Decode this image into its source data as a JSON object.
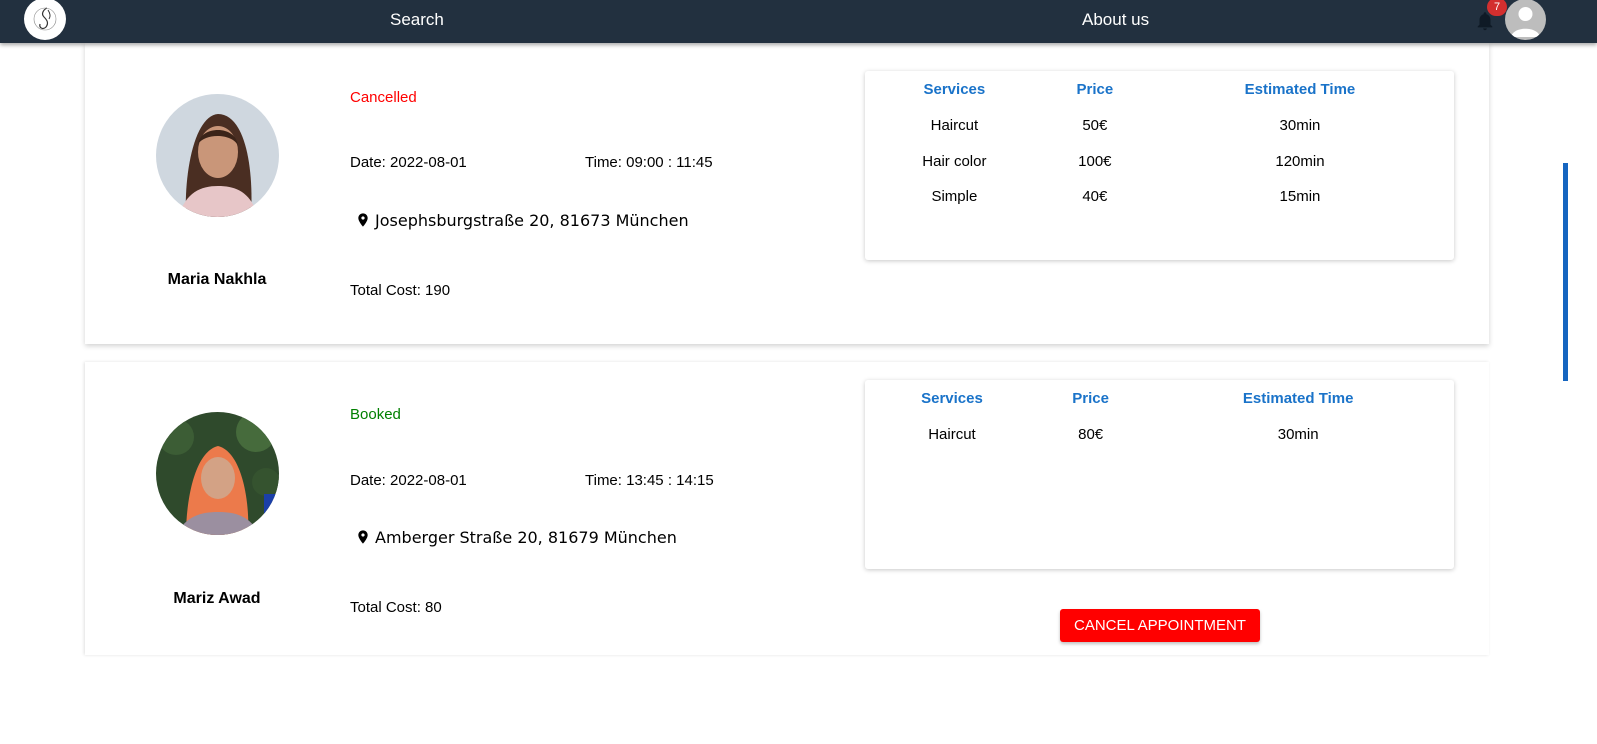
{
  "nav": {
    "search_label": "Search",
    "about_label": "About us",
    "notification_count": "7"
  },
  "table_headers": {
    "services": "Services",
    "price": "Price",
    "estimated_time": "Estimated Time"
  },
  "appointments": [
    {
      "name": "Maria Nakhla",
      "status": "Cancelled",
      "date": "Date: 2022-08-01",
      "time": "Time: 09:00 : 11:45",
      "address": "Josephsburgstraße 20, 81673 München",
      "total": "Total Cost: 190",
      "services": [
        {
          "service": "Haircut",
          "price": "50€",
          "time": "30min"
        },
        {
          "service": "Hair color",
          "price": "100€",
          "time": "120min"
        },
        {
          "service": "Simple",
          "price": "40€",
          "time": "15min"
        }
      ]
    },
    {
      "name": "Mariz Awad",
      "status": "Booked",
      "date": "Date: 2022-08-01",
      "time": "Time: 13:45 : 14:15",
      "address": "Amberger Straße 20, 81679 München",
      "total": "Total Cost: 80",
      "services": [
        {
          "service": "Haircut",
          "price": "80€",
          "time": "30min"
        }
      ],
      "cancel_label": "CANCEL APPOINTMENT"
    }
  ],
  "colors": {
    "navbar": "#22303f",
    "cancelled": "#ff0000",
    "booked": "#008000",
    "header_blue": "#1a73c9",
    "cancel_button": "#ff0000"
  }
}
